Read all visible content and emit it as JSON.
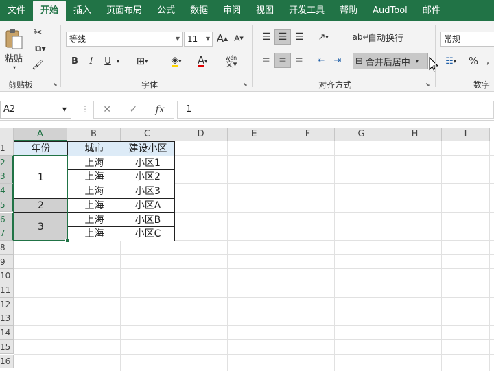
{
  "tabs": [
    "文件",
    "开始",
    "插入",
    "页面布局",
    "公式",
    "数据",
    "审阅",
    "视图",
    "开发工具",
    "帮助",
    "AudTool",
    "邮件"
  ],
  "active_tab": 1,
  "clipboard": {
    "paste_label": "粘贴",
    "group_label": "剪贴板"
  },
  "font": {
    "name": "等线",
    "size": "11",
    "grow": "A",
    "shrink": "A",
    "bold": "B",
    "italic": "I",
    "underline": "U",
    "font_color_glyph": "A",
    "phonetic_glyph": "wén",
    "group_label": "字体"
  },
  "alignment": {
    "wrap_text": "自动换行",
    "merge_center": "合并后居中",
    "group_label": "对齐方式"
  },
  "number": {
    "format": "常规",
    "percent": "%",
    "group_label": "数字"
  },
  "formula_bar": {
    "name_box": "A2",
    "fx": "fx",
    "cancel": "✕",
    "confirm": "✓",
    "value": "1"
  },
  "columns": [
    "A",
    "B",
    "C",
    "D",
    "E",
    "F",
    "G",
    "H",
    "I"
  ],
  "rows": [
    "1",
    "2",
    "3",
    "4",
    "5",
    "6",
    "7",
    "8",
    "9",
    "10",
    "11",
    "12",
    "13",
    "14",
    "15",
    "16"
  ],
  "table": {
    "headers": [
      "年份",
      "城市",
      "建设小区"
    ],
    "year_values": [
      "1",
      "2",
      "3"
    ],
    "cities": [
      "上海",
      "上海",
      "上海",
      "上海",
      "上海",
      "上海"
    ],
    "districts": [
      "小区1",
      "小区2",
      "小区3",
      "小区A",
      "小区B",
      "小区C"
    ]
  },
  "colors": {
    "brand": "#217346",
    "header_fill": "#ddebf7",
    "selected_fill": "#d0d0d0"
  }
}
